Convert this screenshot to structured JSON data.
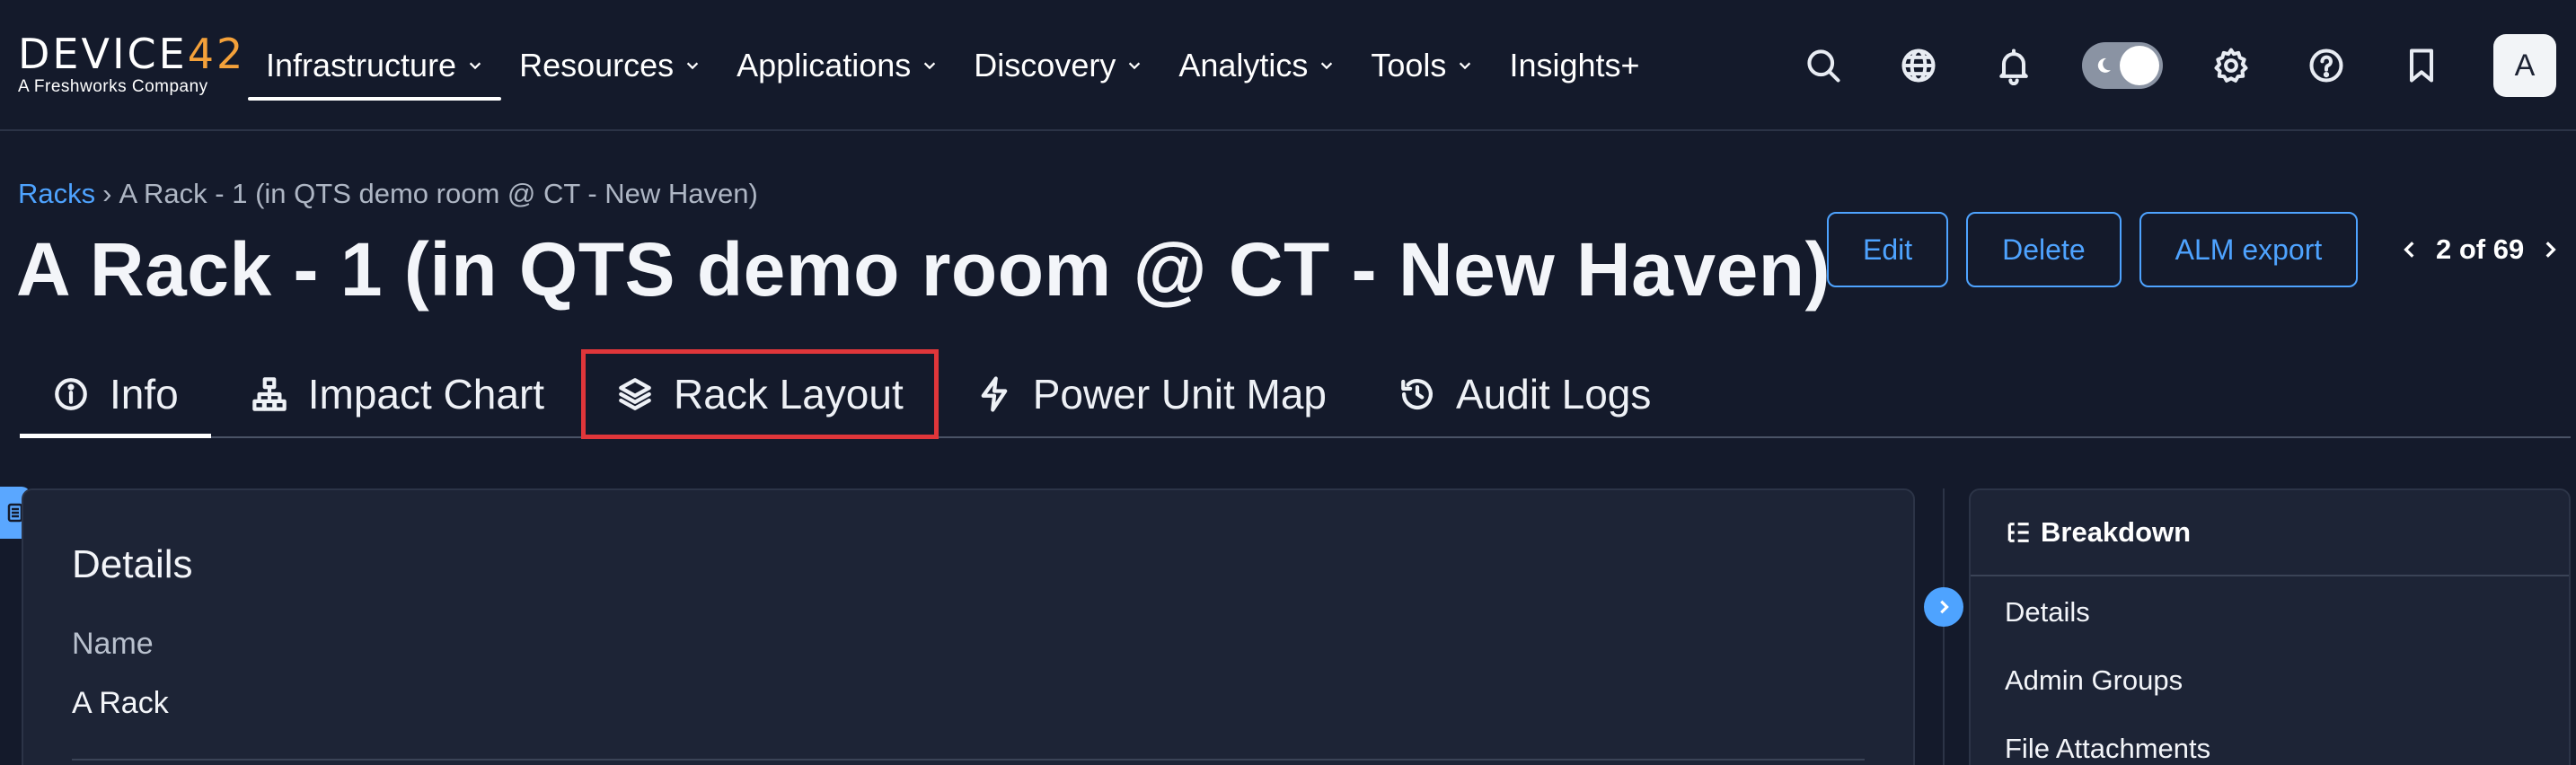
{
  "brand": {
    "logo_prefix": "DEVICE",
    "logo_accent": "42",
    "tagline": "A Freshworks Company",
    "accent_color": "#f4a13a"
  },
  "nav": {
    "items": [
      {
        "label": "Infrastructure",
        "has_menu": true,
        "active": true
      },
      {
        "label": "Resources",
        "has_menu": true
      },
      {
        "label": "Applications",
        "has_menu": true
      },
      {
        "label": "Discovery",
        "has_menu": true
      },
      {
        "label": "Analytics",
        "has_menu": true
      },
      {
        "label": "Tools",
        "has_menu": true
      },
      {
        "label": "Insights+",
        "has_menu": false
      }
    ],
    "right_icons": [
      "search-icon",
      "globe-icon",
      "bell-icon",
      "theme-toggle",
      "gear-icon",
      "help-icon",
      "bookmark-icon"
    ],
    "avatar_initial": "A"
  },
  "breadcrumb": {
    "parent": "Racks",
    "separator": "›",
    "current": "A Rack - 1 (in QTS demo room @ CT - New Haven)"
  },
  "page": {
    "title": "A Rack - 1 (in QTS demo room @ CT - New Haven)"
  },
  "actions": {
    "edit": "Edit",
    "delete": "Delete",
    "alm_export": "ALM export"
  },
  "pager": {
    "label": "2 of 69"
  },
  "tabs": [
    {
      "label": "Info",
      "icon": "info-icon",
      "active": true
    },
    {
      "label": "Impact Chart",
      "icon": "hierarchy-icon"
    },
    {
      "label": "Rack Layout",
      "icon": "layers-icon",
      "highlighted": true
    },
    {
      "label": "Power Unit Map",
      "icon": "bolt-icon"
    },
    {
      "label": "Audit Logs",
      "icon": "history-icon"
    }
  ],
  "details": {
    "heading": "Details",
    "name_label": "Name",
    "name_value": "A Rack"
  },
  "breakdown": {
    "heading": "Breakdown",
    "links": [
      "Details",
      "Admin Groups",
      "File Attachments"
    ]
  },
  "colors": {
    "background": "#141a2b",
    "panel": "#1d2436",
    "link": "#4ea3ff",
    "highlight": "#e0363a"
  }
}
